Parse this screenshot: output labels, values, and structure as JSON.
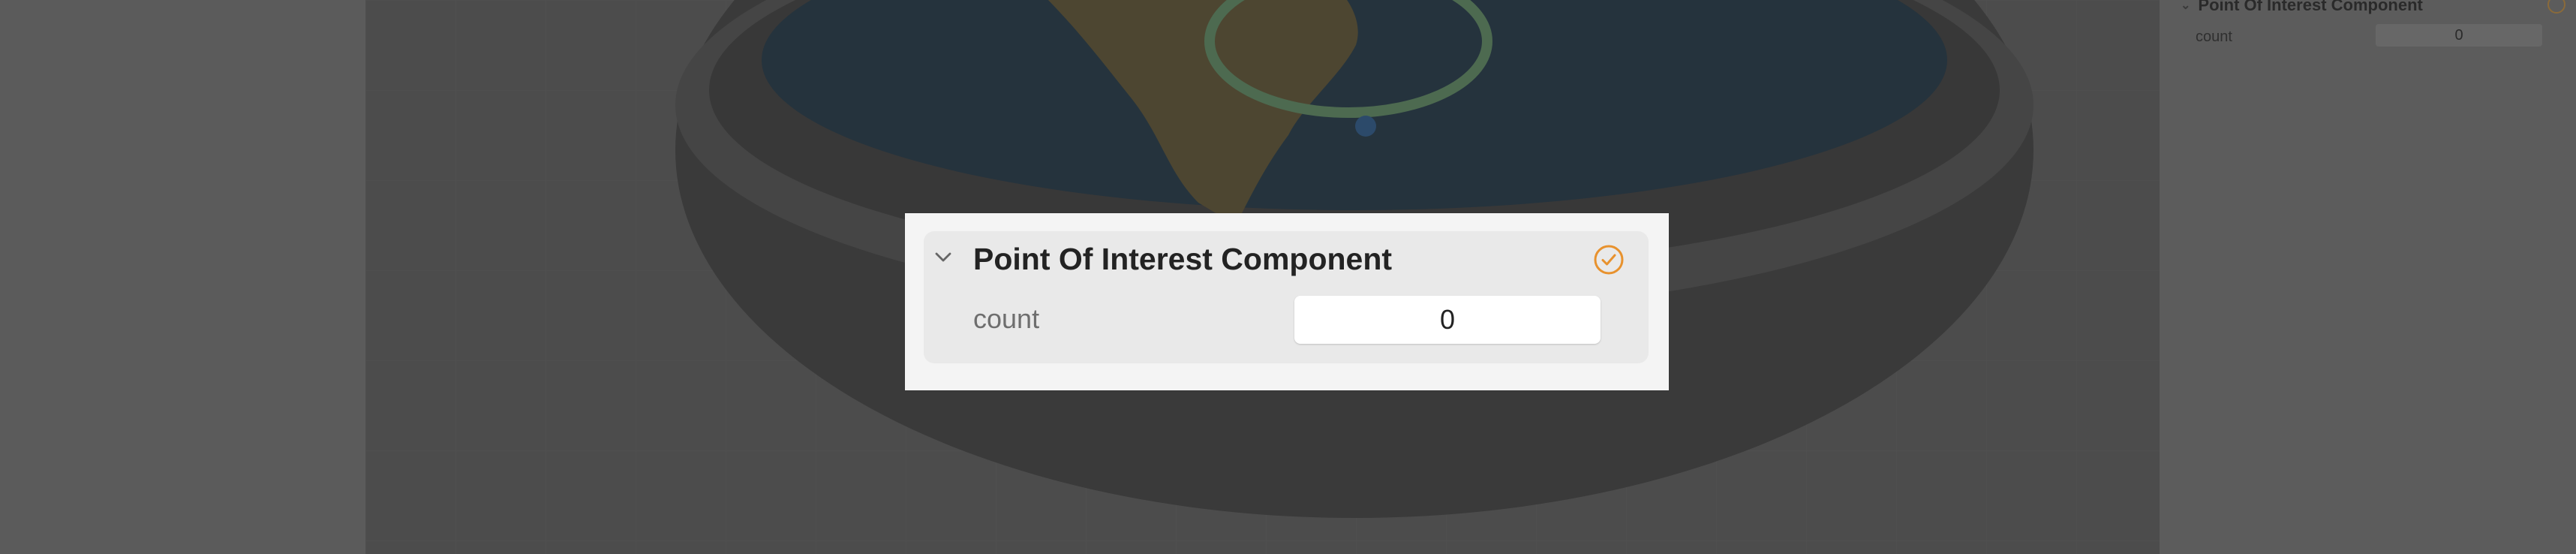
{
  "component": {
    "title": "Point Of Interest Component",
    "enabled": true,
    "field_label": "count",
    "field_value": "0"
  },
  "inspector": {
    "title": "Point Of Interest Component",
    "field_label": "count",
    "field_value": "0"
  },
  "icons": {
    "disclosure": "chevron-down-icon",
    "enabled": "checkmark-circle-icon"
  },
  "colors": {
    "accent": "#e8922e",
    "popup_bg": "#f4f4f4",
    "dim_bg": "#5a5a5a"
  }
}
